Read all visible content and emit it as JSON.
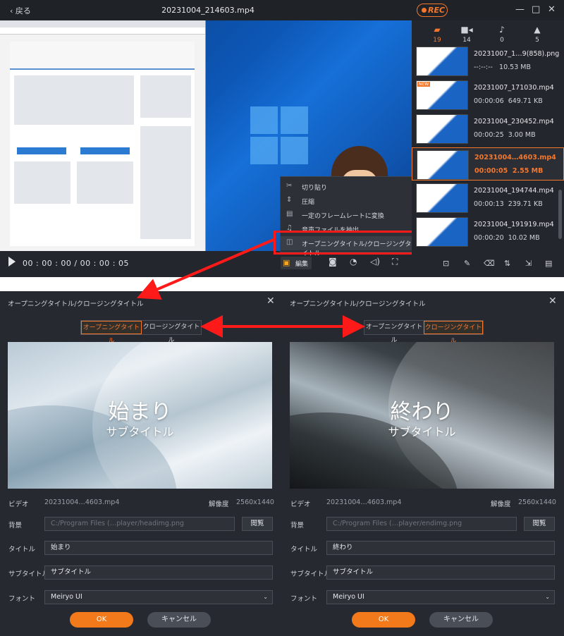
{
  "player": {
    "back_label": "戻る",
    "window_title": "20231004_214603.mp4",
    "rec_label": "REC",
    "time_display": "00 : 00 : 00 / 00 : 00 : 05",
    "edit_label": "編集"
  },
  "context_menu": {
    "items": [
      {
        "icon": "scissors-icon",
        "label": "切り貼り"
      },
      {
        "icon": "compress-icon",
        "label": "圧縮"
      },
      {
        "icon": "framerate-icon",
        "label": "一定のフレームレートに変換"
      },
      {
        "icon": "audio-extract-icon",
        "label": "音声ファイルを抽出"
      },
      {
        "icon": "title-icon",
        "label": "オープニングタイトル/クロージングタイトル"
      }
    ]
  },
  "sidebar": {
    "categories": [
      {
        "icon": "folder-icon",
        "count": "19",
        "active": true
      },
      {
        "icon": "video-icon",
        "count": "14"
      },
      {
        "icon": "audio-icon",
        "count": "0"
      },
      {
        "icon": "image-icon",
        "count": "5"
      }
    ],
    "files": [
      {
        "name": "20231007_1…9(858).png",
        "duration": "--:--:--",
        "size": "10.53 MB",
        "is_new": false
      },
      {
        "name": "20231007_171030.mp4",
        "duration": "00:00:06",
        "size": "649.71 KB",
        "is_new": true
      },
      {
        "name": "20231004_230452.mp4",
        "duration": "00:00:25",
        "size": "3.00 MB",
        "is_new": false
      },
      {
        "name": "20231004…4603.mp4",
        "duration": "00:00:05",
        "size": "2.55 MB",
        "is_new": false,
        "selected": true
      },
      {
        "name": "20231004_194744.mp4",
        "duration": "00:00:13",
        "size": "239.71 KB",
        "is_new": false
      },
      {
        "name": "20231004_191919.mp4",
        "duration": "00:00:20",
        "size": "10.02 MB",
        "is_new": false
      }
    ]
  },
  "opening_dialog": {
    "title": "オープニングタイトル/クロージングタイトル",
    "tab_opening": "オープニングタイトル",
    "tab_closing": "クロージングタイトル",
    "active_tab": "opening",
    "preview_title": "始まり",
    "preview_subtitle": "サブタイトル",
    "video_label": "ビデオ",
    "video_value": "20231004…4603.mp4",
    "resolution_label": "解像度",
    "resolution_value": "2560x1440",
    "background_label": "背景",
    "background_value": "C:/Program Files (…player/headimg.png",
    "browse_label": "閲覧",
    "title_label": "タイトル",
    "title_value": "始まり",
    "subtitle_label": "サブタイトル",
    "subtitle_value": "サブタイトル",
    "font_label": "フォント",
    "font_value": "Meiryo UI",
    "ok_label": "OK",
    "cancel_label": "キャンセル"
  },
  "closing_dialog": {
    "title": "オープニングタイトル/クロージングタイトル",
    "tab_opening": "オープニングタイトル",
    "tab_closing": "クロージングタイトル",
    "active_tab": "closing",
    "preview_title": "終わり",
    "preview_subtitle": "サブタイトル",
    "video_label": "ビデオ",
    "video_value": "20231004…4603.mp4",
    "resolution_label": "解像度",
    "resolution_value": "2560x1440",
    "background_label": "背景",
    "background_value": "C:/Program Files (…player/endimg.png",
    "browse_label": "閲覧",
    "title_label": "タイトル",
    "title_value": "終わり",
    "subtitle_label": "サブタイトル",
    "subtitle_value": "サブタイトル",
    "font_label": "フォント",
    "font_value": "Meiryo UI",
    "ok_label": "OK",
    "cancel_label": "キャンセル"
  },
  "colors": {
    "accent": "#f5772b",
    "annotation_red": "#ff1a1a",
    "panel_bg": "#26292f"
  }
}
